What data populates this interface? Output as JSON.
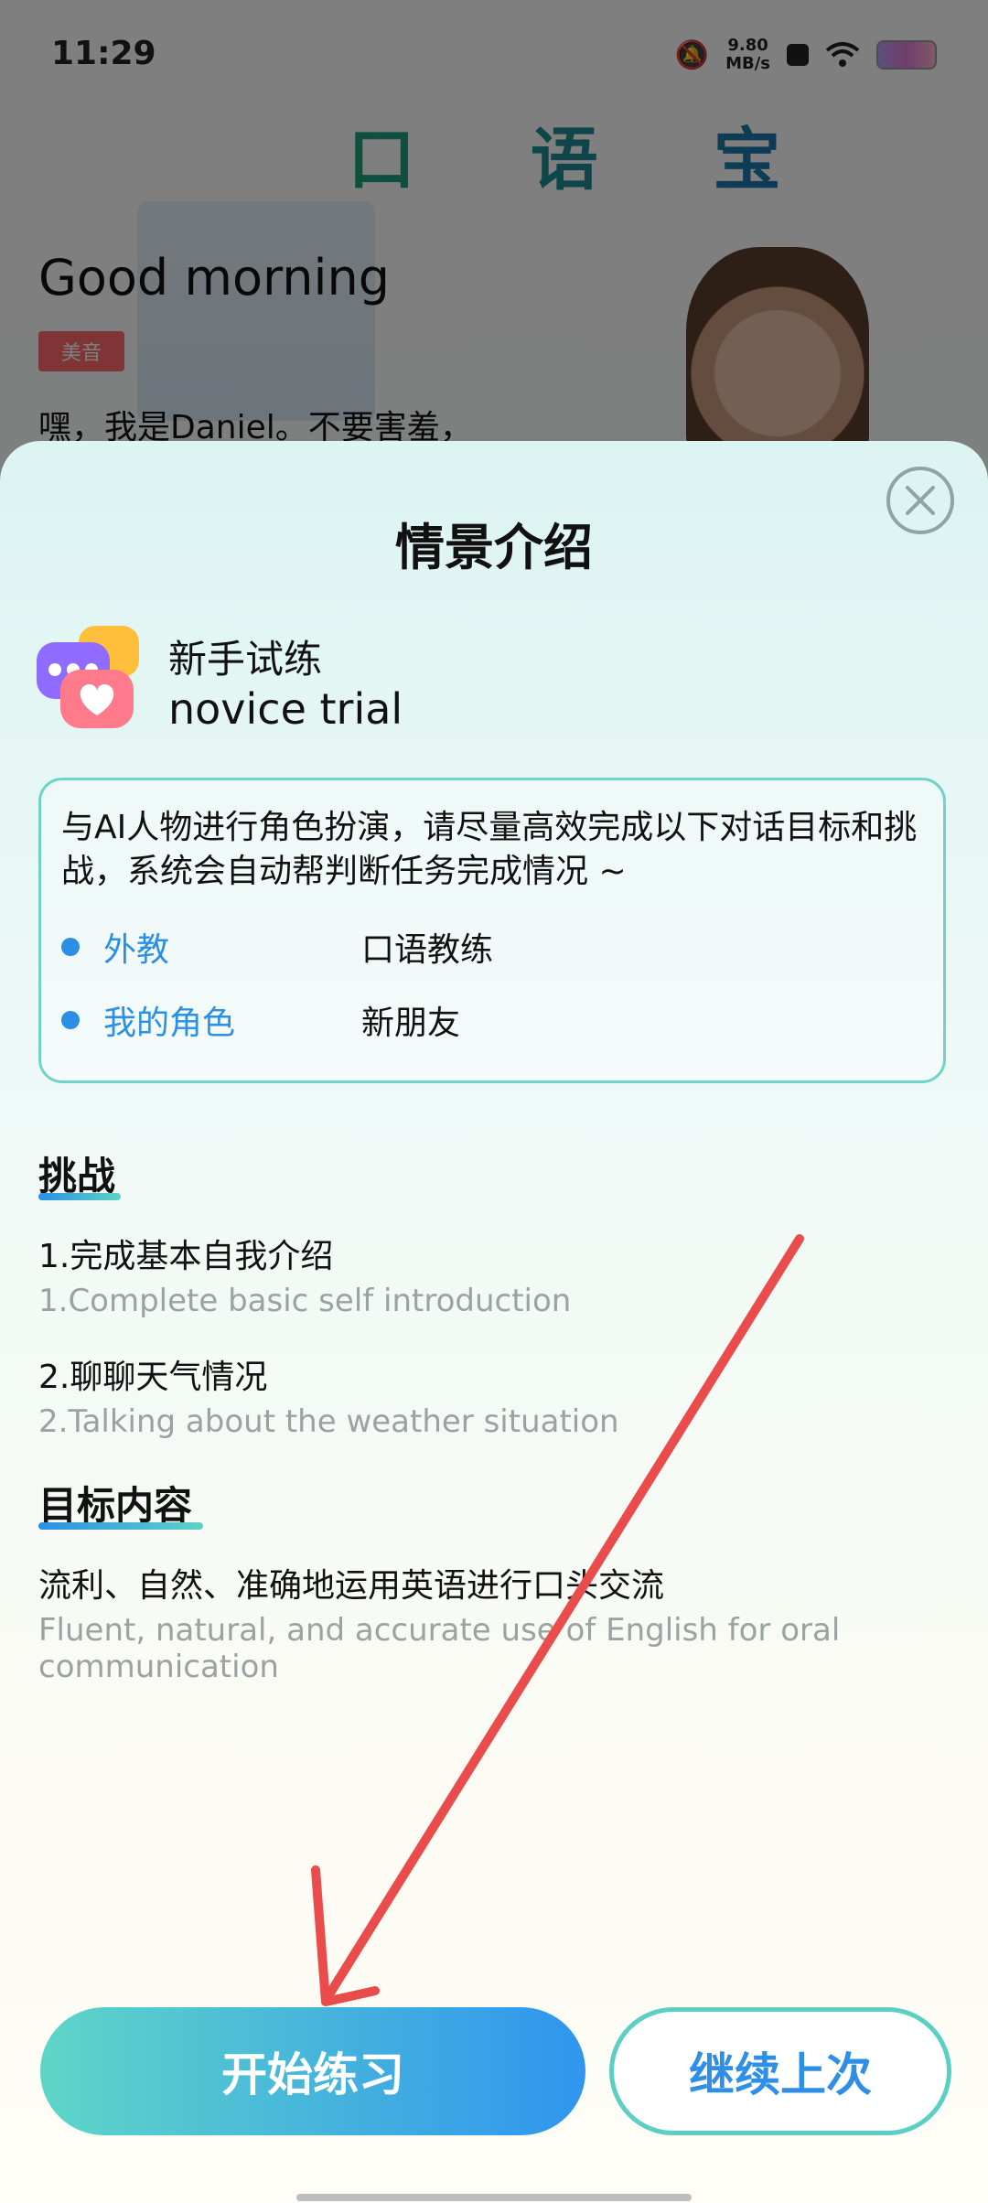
{
  "status_bar": {
    "time": "11:29",
    "speed_value": "9.80",
    "speed_unit": "MB/s"
  },
  "background": {
    "app_name": "口 语 宝",
    "greeting": "Good morning",
    "accent_tag": "美音",
    "intro_text": "嘿，我是Daniel。不要害羞，"
  },
  "sheet": {
    "title": "情景介绍",
    "scene_name_cn": "新手试练",
    "scene_name_en": "novice trial",
    "description": "与AI人物进行角色扮演，请尽量高效完成以下对话目标和挑战，系统会自动帮判断任务完成情况 ~",
    "roles": [
      {
        "key": "外教",
        "value": "口语教练"
      },
      {
        "key": "我的角色",
        "value": "新朋友"
      }
    ],
    "challenge": {
      "title": "挑战",
      "items": [
        {
          "cn": "1.完成基本自我介绍",
          "en": "1.Complete basic self introduction"
        },
        {
          "cn": "2.聊聊天气情况",
          "en": "2.Talking about the weather situation"
        }
      ]
    },
    "goal": {
      "title": "目标内容",
      "cn": "流利、自然、准确地运用英语进行口头交流",
      "en": "Fluent, natural, and accurate use of English for oral communication"
    },
    "buttons": {
      "start": "开始练习",
      "continue": "继续上次"
    }
  },
  "colors": {
    "accent_blue": "#2b8fe6",
    "accent_teal": "#5ed6c7",
    "arrow_red": "#ea4b4b"
  },
  "icons": {
    "close": "close-icon",
    "scene": "chat-bubbles-heart-icon"
  }
}
